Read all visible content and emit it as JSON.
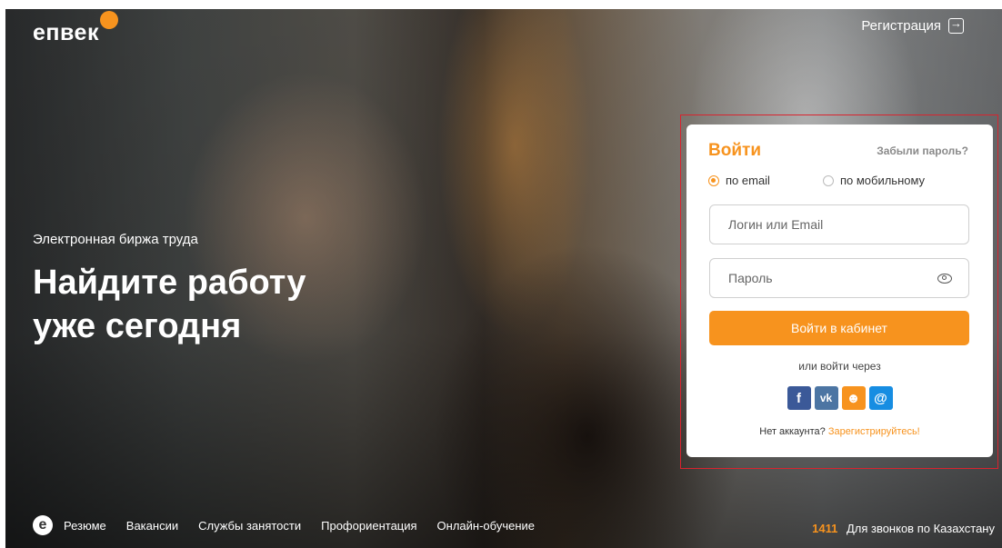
{
  "brand": {
    "logo_text": "епвек",
    "accent": "#f7931e"
  },
  "header": {
    "register_label": "Регистрация",
    "register_icon": "login-arrow-icon"
  },
  "hero": {
    "subtitle": "Электронная биржа труда",
    "headline_line1": "Найдите работу",
    "headline_line2": "уже сегодня"
  },
  "login": {
    "title": "Войти",
    "forgot_label": "Забыли пароль?",
    "radio_email": "по email",
    "radio_phone": "по мобильному",
    "selected_method": "по email",
    "login_placeholder": "Логин или Email",
    "password_placeholder": "Пароль",
    "submit_label": "Войти в кабинет",
    "alt_label": "или войти через",
    "socials": [
      "facebook-icon",
      "vk-icon",
      "odnoklassniki-icon",
      "mailru-icon"
    ],
    "no_account_text": "Нет аккаунта?",
    "register_link": "Зарегистрируйтесь!"
  },
  "footer_nav": {
    "items": [
      "Резюме",
      "Вакансии",
      "Службы занятости",
      "Профориентация",
      "Онлайн-обучение"
    ]
  },
  "hotline": {
    "number": "1411",
    "label": "Для звонков по Казахстану"
  }
}
